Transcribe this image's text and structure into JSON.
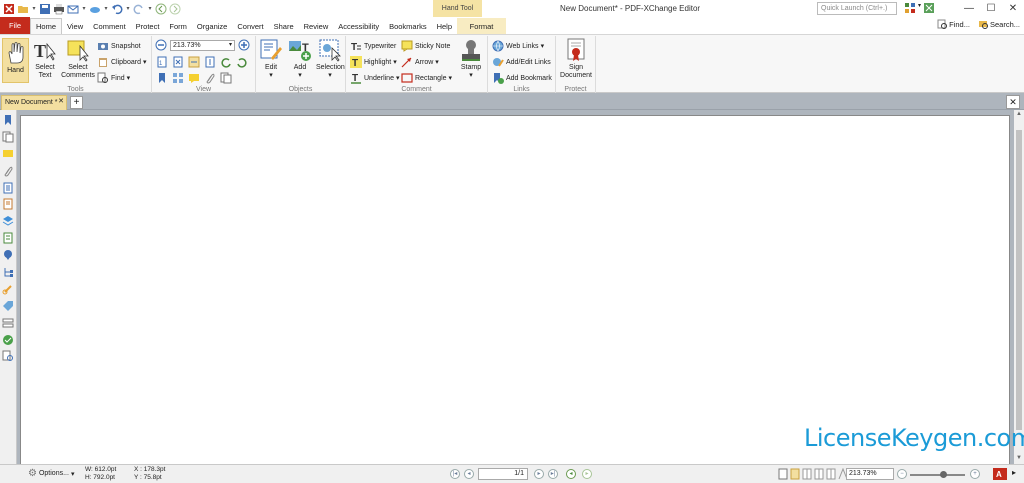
{
  "title_bar": {
    "context_tab_group": "Hand Tool",
    "window_title": "New Document* - PDF-XChange Editor",
    "quick_launch_placeholder": "Quick Launch (Ctrl+.)"
  },
  "tabs": [
    {
      "label": "File"
    },
    {
      "label": "Home"
    },
    {
      "label": "View"
    },
    {
      "label": "Comment"
    },
    {
      "label": "Protect"
    },
    {
      "label": "Form"
    },
    {
      "label": "Organize"
    },
    {
      "label": "Convert"
    },
    {
      "label": "Share"
    },
    {
      "label": "Review"
    },
    {
      "label": "Accessibility"
    },
    {
      "label": "Bookmarks"
    },
    {
      "label": "Help"
    },
    {
      "label": "Format"
    }
  ],
  "tab_right": {
    "find": "Find...",
    "search": "Search..."
  },
  "ribbon": {
    "tools": {
      "label": "Tools",
      "hand": "Hand",
      "select_text": "Select Text",
      "select_comments": "Select Comments",
      "snapshot": "Snapshot",
      "clipboard": "Clipboard",
      "find": "Find"
    },
    "view": {
      "label": "View",
      "zoom": "213.73%"
    },
    "objects": {
      "label": "Objects",
      "edit": "Edit",
      "add": "Add",
      "selection": "Selection"
    },
    "comment": {
      "label": "Comment",
      "typewriter": "Typewriter",
      "highlight": "Highlight",
      "underline": "Underline",
      "sticky_note": "Sticky Note",
      "arrow": "Arrow",
      "rectangle": "Rectangle",
      "stamp": "Stamp"
    },
    "links": {
      "label": "Links",
      "web_links": "Web Links",
      "add_edit_links": "Add/Edit Links",
      "add_bookmark": "Add Bookmark"
    },
    "protect": {
      "label": "Protect",
      "sign_document": "Sign Document"
    }
  },
  "document_tab": {
    "label": "New Document *"
  },
  "watermark": "LicenseKeygen.com",
  "status_bar": {
    "options": "Options...",
    "width": "W: 612.0pt",
    "height": "H: 792.0pt",
    "x": "X : 178.3pt",
    "y": "Y :   75.8pt",
    "page": "1/1",
    "zoom": "213.73%"
  },
  "colors": {
    "file_tab": "#c42b1c",
    "active_tool": "#f3dfa0",
    "workspace": "#aeb5bd",
    "watermark": "#1b9bd7"
  }
}
